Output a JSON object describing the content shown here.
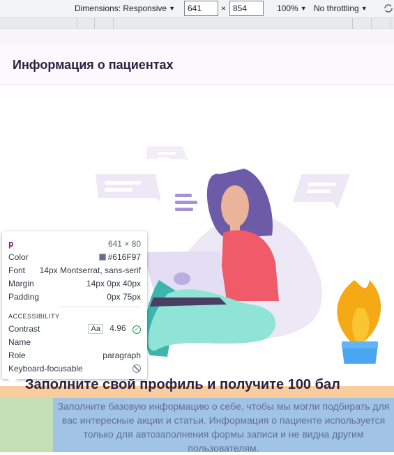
{
  "devtools": {
    "dimensions_label": "Dimensions: Responsive",
    "width_value": "641",
    "times": "×",
    "height_value": "854",
    "zoom": "100%",
    "throttling": "No throttling"
  },
  "page": {
    "title": "Информация о пациентах",
    "profile_heading": "Заполните свой профиль и получите 100 бал",
    "info_paragraph": "Заполните базовую информацию о себе, чтобы мы могли подбирать для вас интересные акции и статьи. Информация о пациенте используется только для автозаполнения формы записи и не видна другим пользователям."
  },
  "inspector": {
    "tag": "p",
    "size": "641 × 80",
    "color_label": "Color",
    "color_value": "#616F97",
    "swatch_color": "#616f97",
    "font_label": "Font",
    "font_value": "14px Montserrat, sans-serif",
    "margin_label": "Margin",
    "margin_value": "14px 0px 40px",
    "padding_label": "Padding",
    "padding_value": "0px 75px",
    "accessibility_label": "ACCESSIBILITY",
    "contrast_label": "Contrast",
    "contrast_aa": "Aa",
    "contrast_value": "4.96",
    "name_label": "Name",
    "role_label": "Role",
    "role_value": "paragraph",
    "keyboard_label": "Keyboard-focusable"
  },
  "colors": {
    "highlight_margin": "#f9cc9d",
    "highlight_padding": "#c3dfb5",
    "highlight_content": "#a0c3e6",
    "text": "#616f97"
  }
}
